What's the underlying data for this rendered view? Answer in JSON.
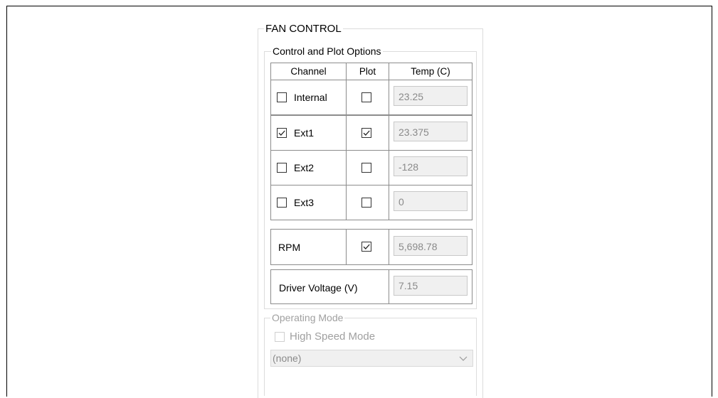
{
  "fan_control": {
    "title": "FAN CONTROL",
    "control_plot_options": {
      "title": "Control and Plot Options",
      "headers": {
        "channel": "Channel",
        "plot": "Plot",
        "temp": "Temp (C)"
      },
      "rows": [
        {
          "label": "Internal",
          "channel_checked": false,
          "plot_checked": false,
          "temp": "23.25"
        },
        {
          "label": "Ext1",
          "channel_checked": true,
          "plot_checked": true,
          "temp": "23.375"
        },
        {
          "label": "Ext2",
          "channel_checked": false,
          "plot_checked": false,
          "temp": "-128"
        },
        {
          "label": "Ext3",
          "channel_checked": false,
          "plot_checked": false,
          "temp": "0"
        }
      ],
      "rpm": {
        "label": "RPM",
        "plot_checked": true,
        "value": "5,698.78"
      },
      "driver_voltage": {
        "label": "Driver Voltage (V)",
        "value": "7.15"
      }
    },
    "operating_mode": {
      "title": "Operating Mode",
      "high_speed_label": "High Speed Mode",
      "high_speed_checked": false,
      "selected": "(none)"
    }
  },
  "icons": {
    "check": "check-icon",
    "dropdown": "chevron-down-icon"
  },
  "colors": {
    "border": "#8c8c8c",
    "disabled_text": "#a0a0a0",
    "field_bg": "#f0f0f0"
  }
}
